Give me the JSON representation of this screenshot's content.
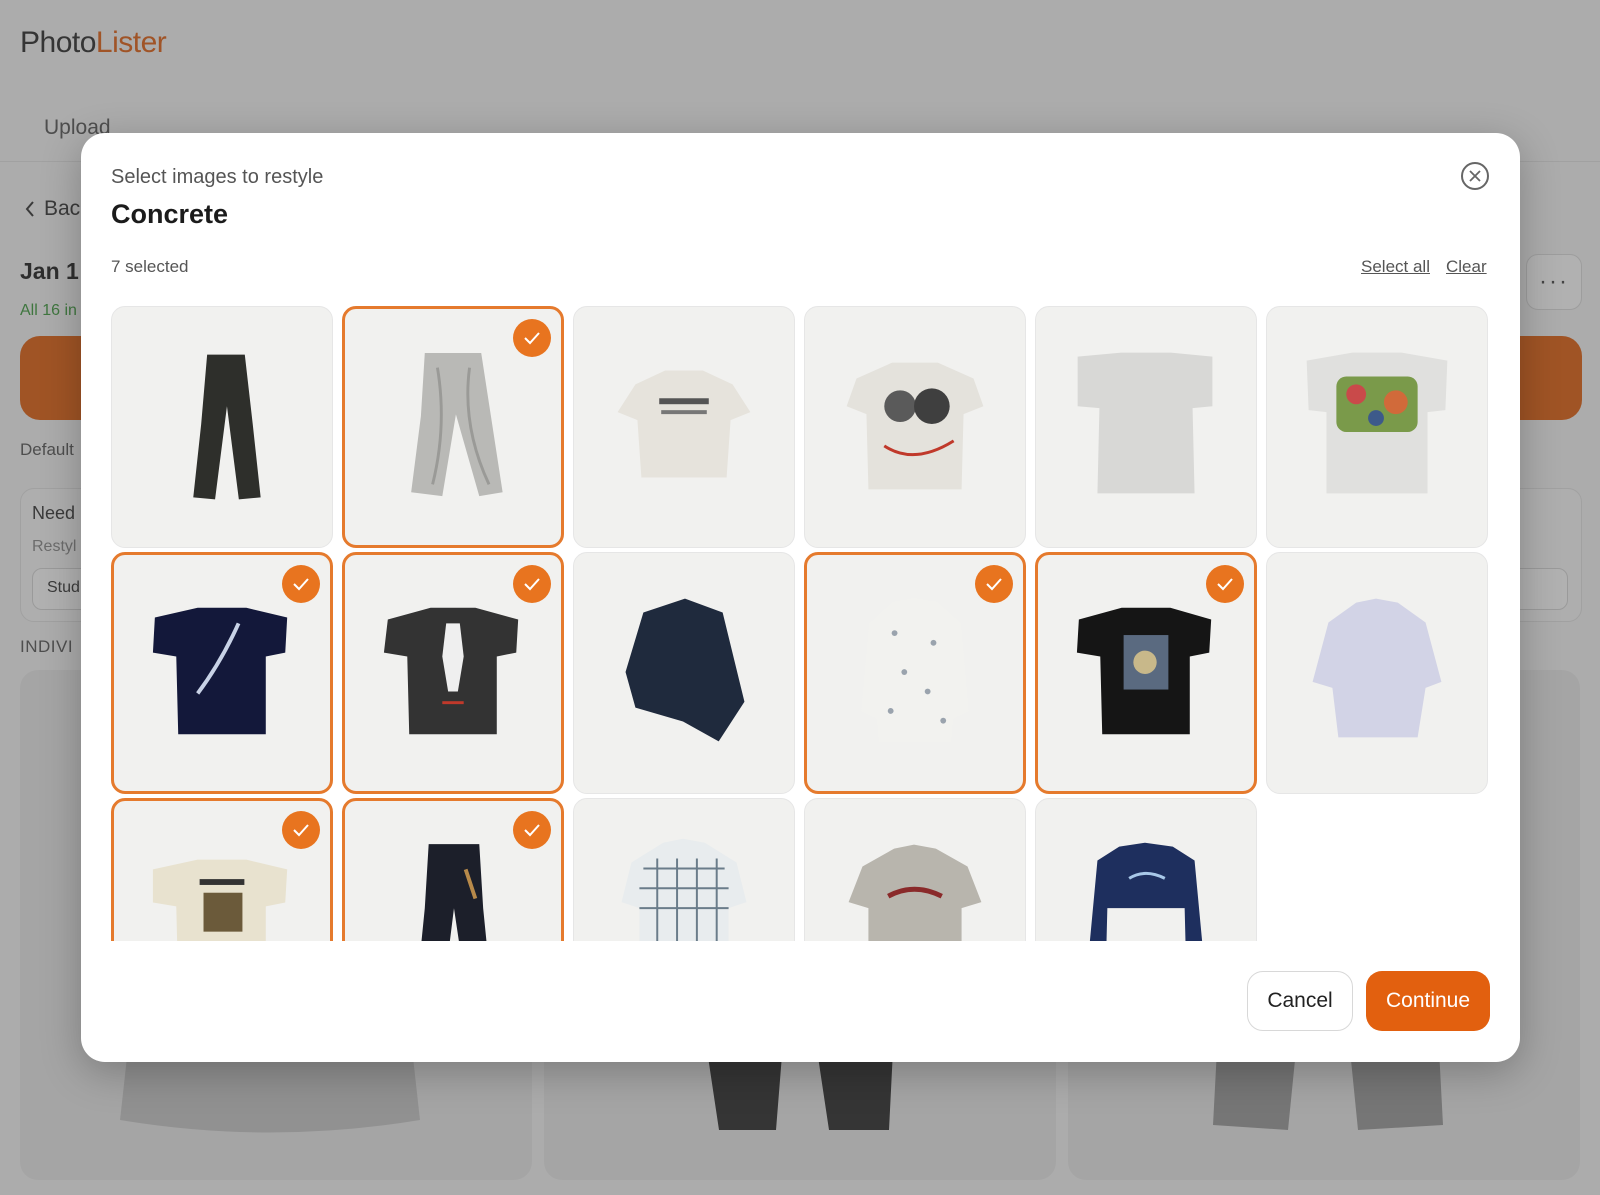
{
  "app": {
    "logo_part1": "Photo",
    "logo_part2": "Lister",
    "nav_tab": "Upload",
    "back_label": "Bac",
    "date_title": "Jan 1",
    "status_text": "All 16 in",
    "more_label": "···",
    "default_label": "Default",
    "need_label": "Need",
    "restyle_label": "Restyl",
    "studio_value": "Stud",
    "individual_label": "INDIVI"
  },
  "modal": {
    "subtitle": "Select images to restyle",
    "title": "Concrete",
    "selected_count": "7 selected",
    "select_all": "Select all",
    "clear": "Clear",
    "cancel": "Cancel",
    "continue": "Continue",
    "tiles": [
      {
        "item": "black trousers",
        "selected": false
      },
      {
        "item": "grey patterned trousers",
        "selected": true
      },
      {
        "item": "white graphic tee",
        "selected": false
      },
      {
        "item": "white portrait graphic tee",
        "selected": false
      },
      {
        "item": "plain grey tee",
        "selected": false
      },
      {
        "item": "white floral graphic tee",
        "selected": false
      },
      {
        "item": "navy space graphic tee",
        "selected": true
      },
      {
        "item": "black figure graphic tee",
        "selected": true
      },
      {
        "item": "navy suit",
        "selected": false
      },
      {
        "item": "white patterned shirt",
        "selected": true
      },
      {
        "item": "black photo tee",
        "selected": true
      },
      {
        "item": "lavender dress shirt",
        "selected": false
      },
      {
        "item": "cream graphic tee",
        "selected": true
      },
      {
        "item": "dark flared jeans",
        "selected": true
      },
      {
        "item": "plaid short-sleeve shirt",
        "selected": false
      },
      {
        "item": "grey embroidered shirt",
        "selected": false
      },
      {
        "item": "navy long-sleeve tee",
        "selected": false
      }
    ]
  },
  "colors": {
    "accent": "#e2600f",
    "selected_border": "#e57a2d",
    "status_green": "#3b9a3b"
  }
}
